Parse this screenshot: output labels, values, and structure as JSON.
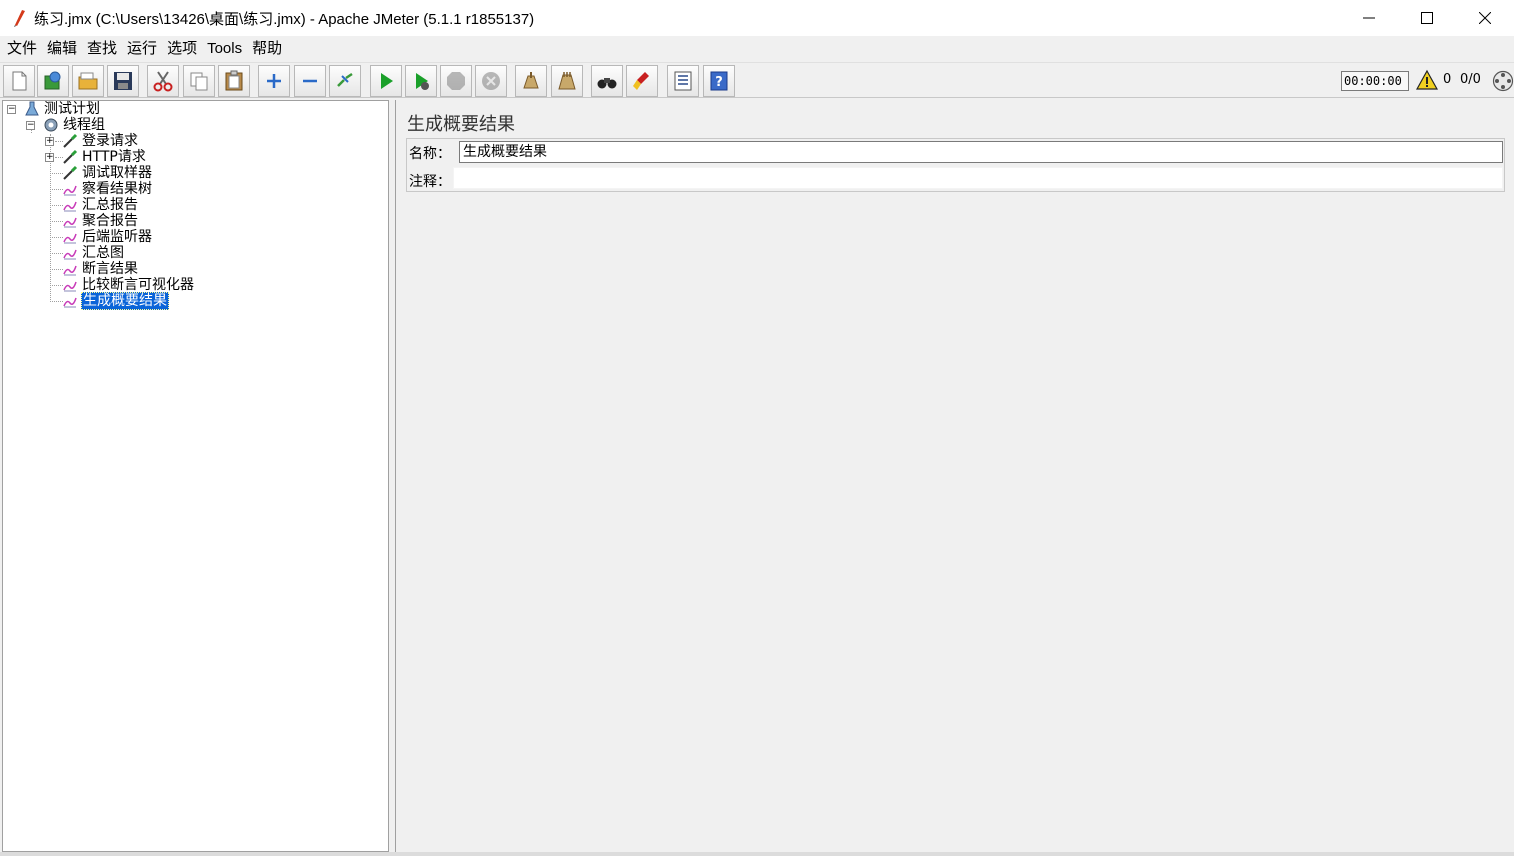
{
  "window": {
    "title": "练习.jmx (C:\\Users\\13426\\桌面\\练习.jmx) - Apache JMeter (5.1.1 r1855137)"
  },
  "menu": [
    "文件",
    "编辑",
    "查找",
    "运行",
    "选项",
    "Tools",
    "帮助"
  ],
  "toolbar": {
    "icons": [
      "new-icon",
      "templates-icon",
      "open-icon",
      "save-icon",
      "cut-icon",
      "copy-icon",
      "paste-icon",
      "expand-icon",
      "collapse-icon",
      "toggle-icon",
      "start-icon",
      "start-no-pause-icon",
      "stop-icon",
      "shutdown-icon",
      "clear-icon",
      "clear-all-icon",
      "search-icon",
      "reset-search-icon",
      "function-helper-icon",
      "help-icon"
    ],
    "timer": "00:00:00",
    "error_count": "0",
    "thread_count": "0/0"
  },
  "tree": {
    "root": "测试计划",
    "thread_group": "线程组",
    "children": [
      "登录请求",
      "HTTP请求",
      "调试取样器",
      "察看结果树",
      "汇总报告",
      "聚合报告",
      "后端监听器",
      "汇总图",
      "断言结果",
      "比较断言可视化器",
      "生成概要结果"
    ],
    "selected": "生成概要结果"
  },
  "panel": {
    "title": "生成概要结果",
    "name_label": "名称：",
    "name_value": "生成概要结果",
    "comment_label": "注释：",
    "comment_value": ""
  }
}
